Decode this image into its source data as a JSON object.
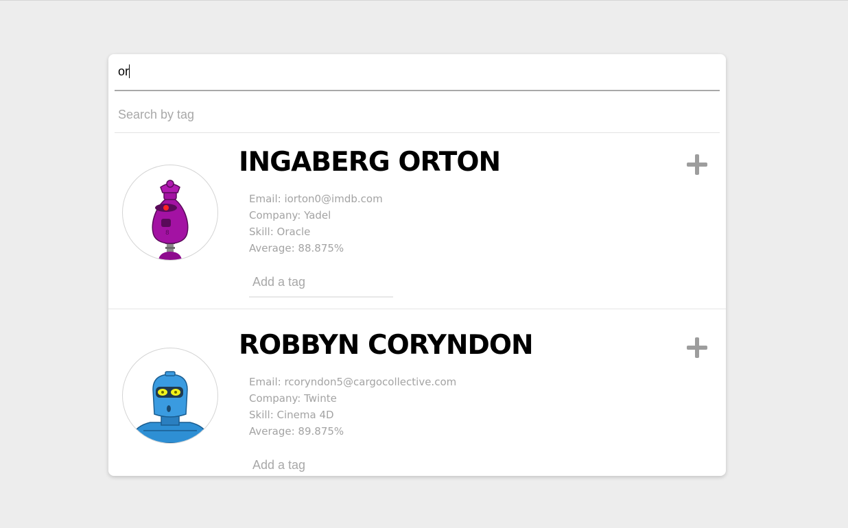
{
  "search": {
    "name_value": "or",
    "tag_placeholder": "Search by tag"
  },
  "students": [
    {
      "name": "INGABERG ORTON",
      "email": "Email: iorton0@imdb.com",
      "company": "Company: Yadel",
      "skill": "Skill: Oracle",
      "average": "Average: 88.875%",
      "tag_placeholder": "Add a tag",
      "avatar_icon": "purple-robot-avatar"
    },
    {
      "name": "ROBBYN CORYNDON",
      "email": "Email: rcoryndon5@cargocollective.com",
      "company": "Company: Twinte",
      "skill": "Skill: Cinema 4D",
      "average": "Average: 89.875%",
      "tag_placeholder": "Add a tag",
      "avatar_icon": "blue-robot-avatar"
    }
  ],
  "colors": {
    "background": "#ededed",
    "card": "#ffffff",
    "muted_text": "#a3a3a3",
    "plus_icon": "#9d9d9d"
  }
}
